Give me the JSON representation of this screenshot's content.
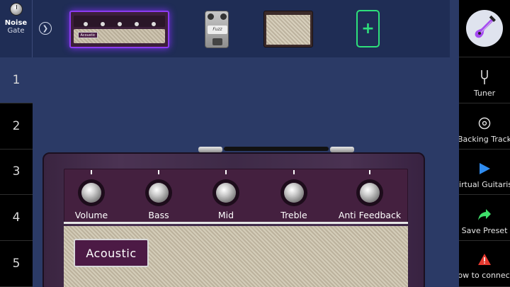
{
  "chain": {
    "noise_gate": {
      "title": "Noise",
      "subtitle": "Gate"
    },
    "pedal_label": "Fuzz",
    "amp_badge_mini": "Acoustic",
    "add_label": "+"
  },
  "presets": [
    "1",
    "2",
    "3",
    "4",
    "5"
  ],
  "active_preset": "1",
  "sidebar": {
    "tuner": "Tuner",
    "backing": "Backing Track",
    "virtual": "Virtual Guitarist",
    "save": "Save Preset",
    "connect": "How to connect?"
  },
  "amp": {
    "controls": [
      {
        "label": "Volume"
      },
      {
        "label": "Bass"
      },
      {
        "label": "Mid"
      },
      {
        "label": "Treble"
      },
      {
        "label": "Anti Feedback"
      }
    ],
    "badge": "Acoustic"
  },
  "colors": {
    "accent_purple": "#8d3bf0",
    "add_green": "#2ee07b",
    "play_blue": "#2f8cf0",
    "save_green": "#3ee06a",
    "warn_red": "#e5392f"
  }
}
